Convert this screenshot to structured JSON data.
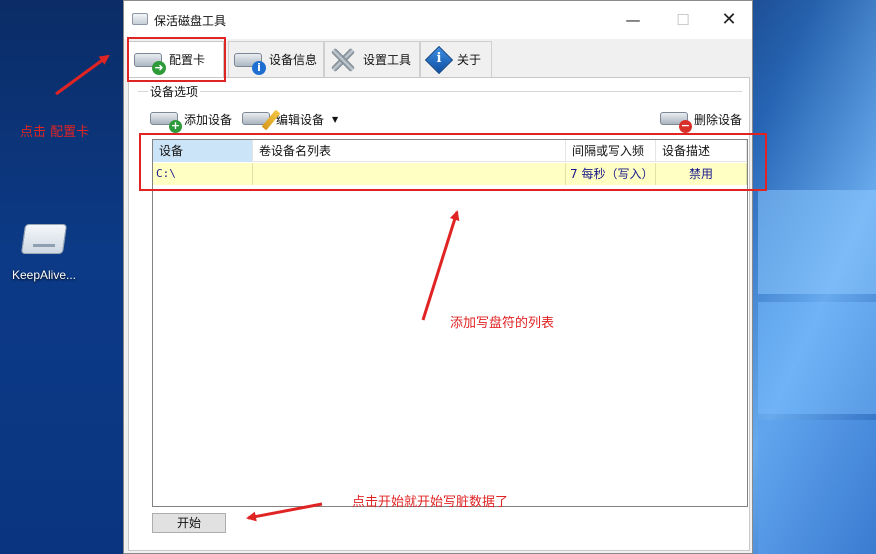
{
  "desktop": {
    "icon_label": "KeepAlive..."
  },
  "window": {
    "title": "保活磁盘工具",
    "controls": {
      "minimize": "—",
      "maximize": "☐",
      "close": "✕"
    }
  },
  "tabs": [
    {
      "label": "配置卡",
      "icon": "drive-arrow-icon",
      "active": true
    },
    {
      "label": "设备信息",
      "icon": "drive-info-icon",
      "active": false
    },
    {
      "label": "设置工具",
      "icon": "tools-icon",
      "active": false
    },
    {
      "label": "关于",
      "icon": "about-icon",
      "active": false
    }
  ],
  "group": {
    "title": "设备选项"
  },
  "toolbar": {
    "add_label": "添加设备",
    "edit_label": "编辑设备",
    "edit_caret": "▼",
    "delete_label": "删除设备"
  },
  "listview": {
    "columns": [
      "设备",
      "卷设备名列表",
      "间隔或写入频",
      "设备描述"
    ],
    "rows": [
      {
        "device": "C:\\",
        "volumes": "",
        "interval": "7 每秒（写入）",
        "description": "禁用"
      }
    ]
  },
  "start_button": {
    "label": "开始"
  },
  "annotations": {
    "click_tab": "点击 配置卡",
    "list_note": "添加写盘符的列表",
    "start_note": "点击开始就开始写脏数据了",
    "color": "#e02424"
  }
}
